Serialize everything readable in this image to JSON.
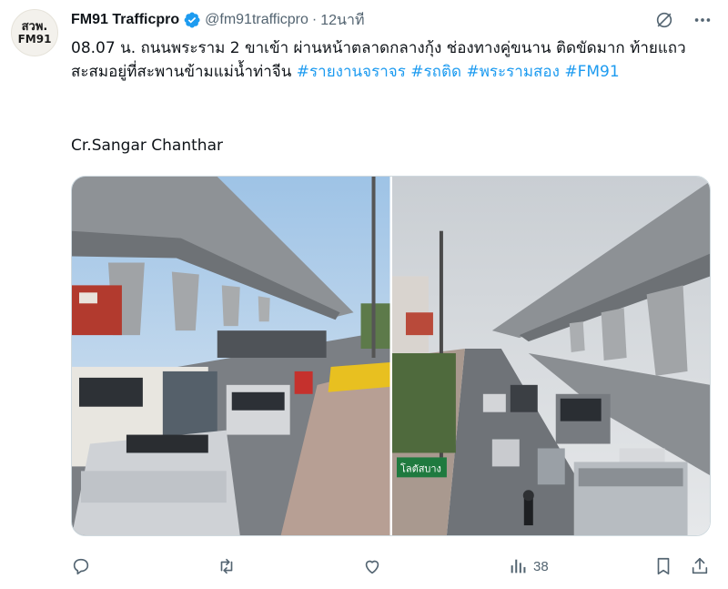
{
  "author": {
    "avatar_line1": "สวพ.",
    "avatar_line2": "FM91",
    "display_name": "FM91 Trafficpro",
    "handle": "@fm91trafficpro",
    "separator": "·",
    "time": "12นาที"
  },
  "tweet": {
    "text_main": "08.07 น. ถนนพระราม 2 ขาเข้า ผ่านหน้าตลาดกลางกุ้ง ช่องทางคู่ขนาน ติดขัดมาก ท้ายแถวสะสมอยู่ที่สะพานข้ามแม่น้ำท่าจีน ",
    "hashtags": [
      "#รายงานจราจร",
      "#รถติด",
      "#พระรามสอง",
      "#FM91"
    ],
    "credit": "Cr.Sangar Chanthar"
  },
  "media": {
    "photo_right_sign": "โลตัส​บาง"
  },
  "metrics": {
    "views": "38"
  },
  "colors": {
    "accent": "#1d9bf0",
    "muted": "#536471",
    "text": "#0f1419"
  },
  "icons": [
    "verified-badge-icon",
    "grok-icon",
    "more-icon",
    "reply-icon",
    "retweet-icon",
    "like-icon",
    "views-icon",
    "bookmark-icon",
    "share-icon"
  ]
}
